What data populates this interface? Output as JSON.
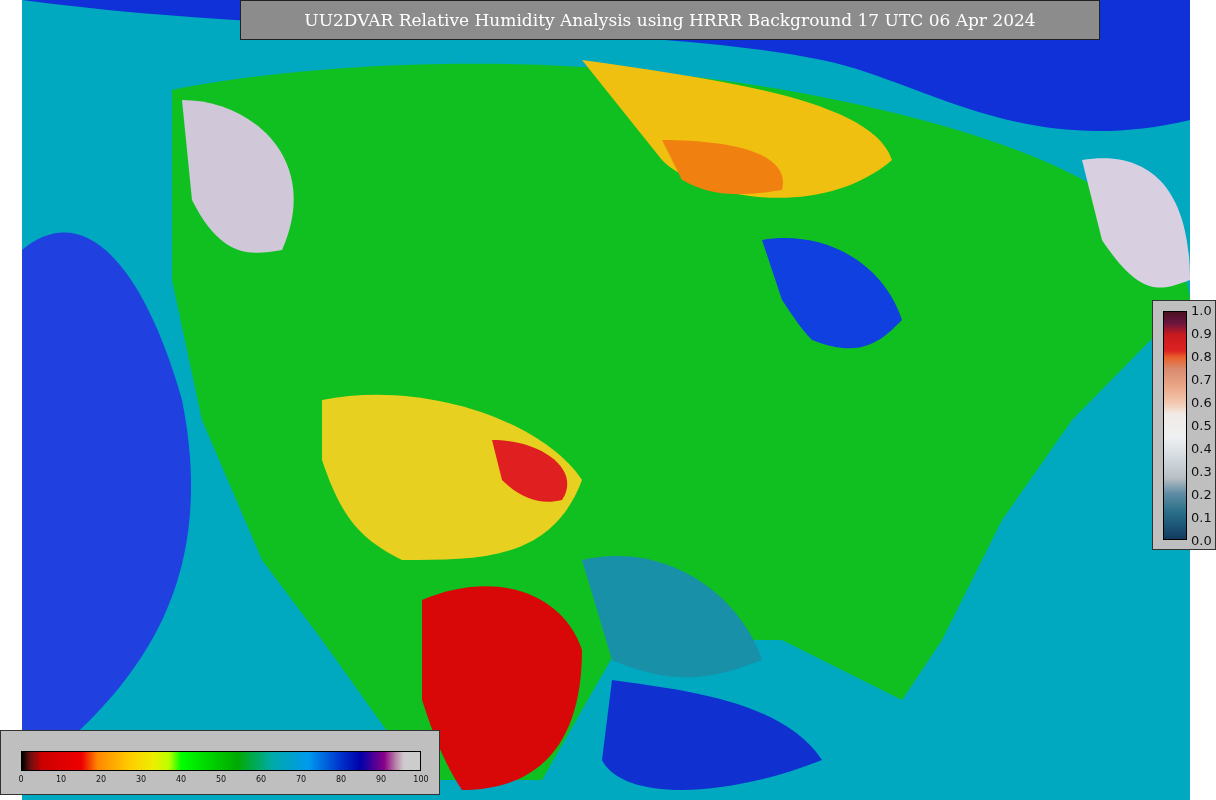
{
  "title": "UU2DVAR Relative Humidity Analysis using HRRR Background 17 UTC 06 Apr 2024",
  "colorbar_right": {
    "ticks": [
      "1.0",
      "0.9",
      "0.8",
      "0.7",
      "0.6",
      "0.5",
      "0.4",
      "0.3",
      "0.2",
      "0.1",
      "0.0"
    ]
  },
  "colorbar_bottom": {
    "ticks": [
      "0",
      "10",
      "20",
      "30",
      "40",
      "50",
      "60",
      "70",
      "80",
      "90",
      "100"
    ]
  }
}
